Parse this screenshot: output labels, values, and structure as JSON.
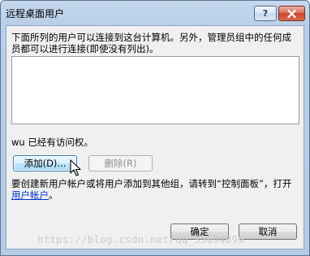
{
  "window": {
    "title": "远程桌面用户",
    "help_glyph": "?"
  },
  "dialog": {
    "intro_text": "下面所列的用户可以连接到这台计算机。另外，管理员组中的任何成员都可以进行连接(即使没有列出)。",
    "access_text": "wu 已经有访问权。",
    "add_button_label": "添加(D)...",
    "remove_button_label": "删除(R)",
    "info_text": "要创建新用户帐户或将用户添加到其他组，请转到“控制面板”，打开",
    "info_link": "用户帐户",
    "info_suffix": "。",
    "ok_label": "确定",
    "cancel_label": "取消"
  },
  "watermark": "https://blog.csdn.net/qq_35694099",
  "colors": {
    "close_button": "#c8452b",
    "link": "#0033cc",
    "add_button_highlight": "#bee6fd"
  },
  "icons": {
    "close": "close-icon",
    "help": "help-icon",
    "pointer": "mouse-pointer-icon"
  }
}
